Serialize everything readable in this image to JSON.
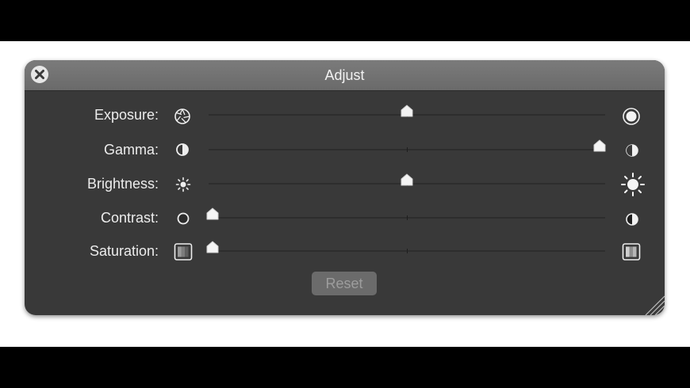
{
  "window": {
    "title": "Adjust"
  },
  "rows": [
    {
      "label": "Exposure:",
      "left_icon": "aperture-closed-icon",
      "right_icon": "aperture-open-icon",
      "value": 0.5
    },
    {
      "label": "Gamma:",
      "left_icon": "gamma-low-icon",
      "right_icon": "gamma-high-icon",
      "value": 0.98
    },
    {
      "label": "Brightness:",
      "left_icon": "sun-small-icon",
      "right_icon": "sun-large-icon",
      "value": 0.5
    },
    {
      "label": "Contrast:",
      "left_icon": "contrast-low-icon",
      "right_icon": "contrast-high-icon",
      "value": 0.0
    },
    {
      "label": "Saturation:",
      "left_icon": "saturation-low-icon",
      "right_icon": "saturation-high-icon",
      "value": 0.0
    }
  ],
  "reset": {
    "label": "Reset",
    "enabled": false
  },
  "colors": {
    "panel": "#393939",
    "titlebar": "#727272",
    "text": "#ececec",
    "thumb": "#f4f4f4"
  }
}
